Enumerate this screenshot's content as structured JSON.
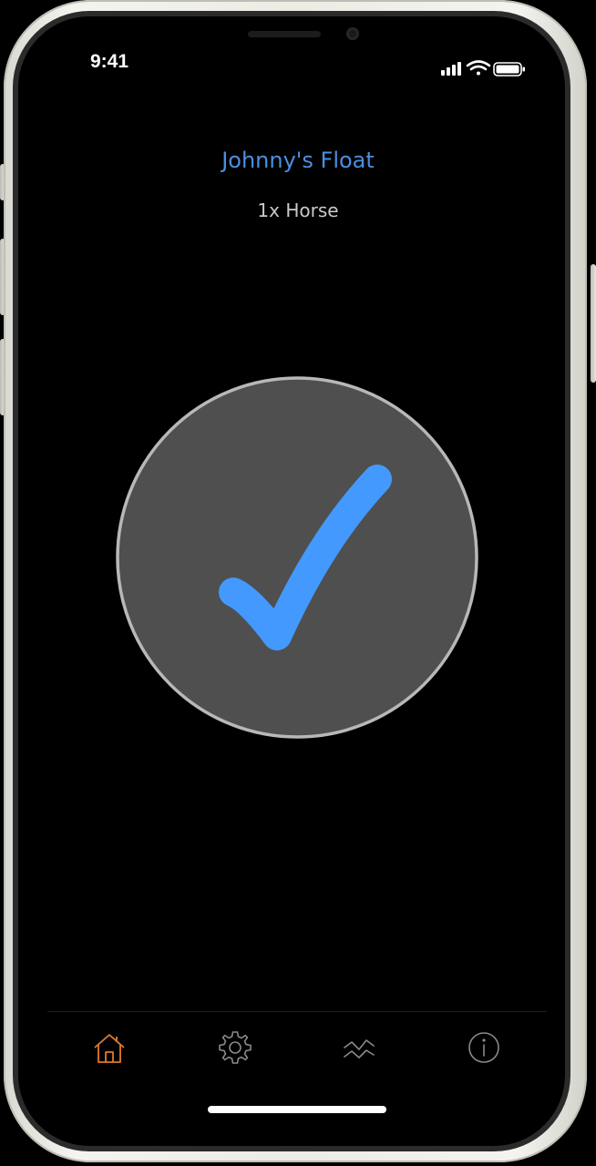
{
  "status_bar": {
    "time": "9:41",
    "icons": [
      "cellular-signal-icon",
      "wifi-icon",
      "battery-icon"
    ]
  },
  "header": {
    "title": "Johnny's Float",
    "subtitle": "1x Horse"
  },
  "status_indicator": {
    "icon": "checkmark-icon",
    "state": "checked"
  },
  "tab_bar": {
    "items": [
      {
        "icon": "home-icon",
        "active": true
      },
      {
        "icon": "gear-icon",
        "active": false
      },
      {
        "icon": "chart-trend-icon",
        "active": false
      },
      {
        "icon": "info-icon",
        "active": false
      }
    ]
  },
  "colors": {
    "accent_blue": "#4a8fe0",
    "check_blue": "#4499ff",
    "active_tab": "#e07a2e",
    "inactive_tab": "#8a8a8a",
    "circle_fill": "#4f4f4f",
    "circle_border": "#b8b8b8",
    "subtitle_gray": "#c9c9c9",
    "background": "#000000"
  }
}
